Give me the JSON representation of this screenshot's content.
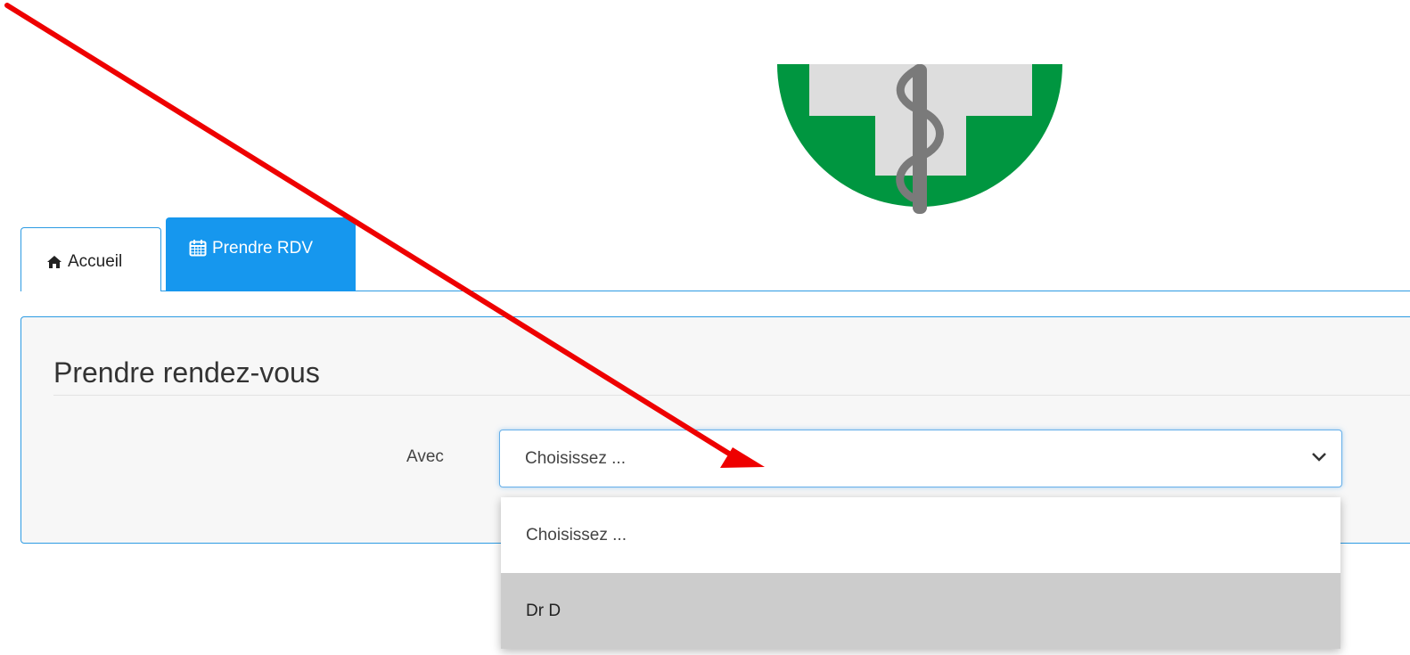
{
  "logo": {
    "alt": "medical-cross-logo",
    "colors": {
      "circle": "#009640",
      "cross": "#dddddd",
      "staff": "#7a7a7a"
    }
  },
  "tabs": [
    {
      "label": "Accueil",
      "icon": "home-icon",
      "active": false
    },
    {
      "label": "Prendre RDV",
      "icon": "calendar-icon",
      "active": true
    }
  ],
  "panel": {
    "title": "Prendre rendez-vous",
    "field_label": "Avec",
    "select": {
      "value": "Choisissez ...",
      "icon": "chevron-down-icon"
    },
    "options": [
      {
        "label": "Choisissez ...",
        "highlighted": false
      },
      {
        "label": "Dr D",
        "highlighted": true
      }
    ]
  },
  "annotation": {
    "type": "arrow",
    "color": "#ee0000"
  },
  "colors": {
    "accent": "#1697ee",
    "border": "#2d9be3"
  }
}
